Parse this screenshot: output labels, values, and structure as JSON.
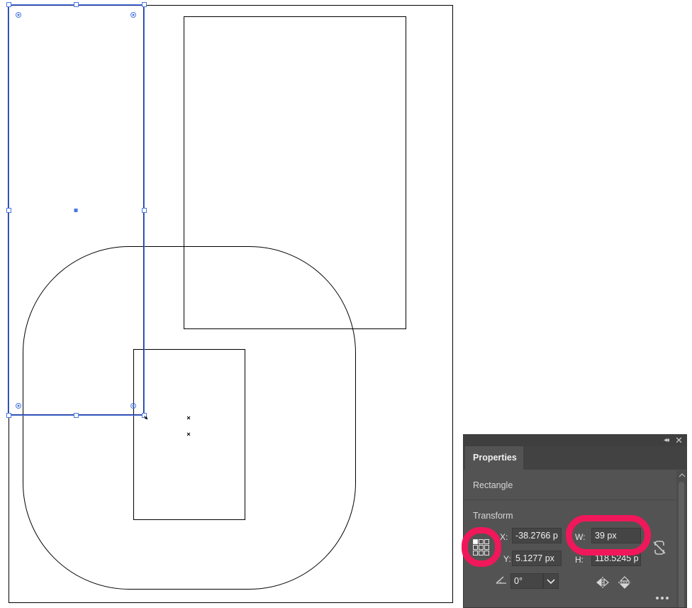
{
  "panel": {
    "tab_label": "Properties",
    "object_type": "Rectangle",
    "section_label": "Transform",
    "x_label": "X:",
    "x_value": "-38.2766 p",
    "y_label": "Y:",
    "y_value": "5.1277 px",
    "w_label": "W:",
    "w_value": "39 px",
    "h_label": "H:",
    "h_value": "118.5245 p",
    "rotation_value": "0°"
  },
  "colors": {
    "annotation_highlight": "#f0185a",
    "selection": "#4a78e0",
    "panel_bg": "#535353"
  }
}
